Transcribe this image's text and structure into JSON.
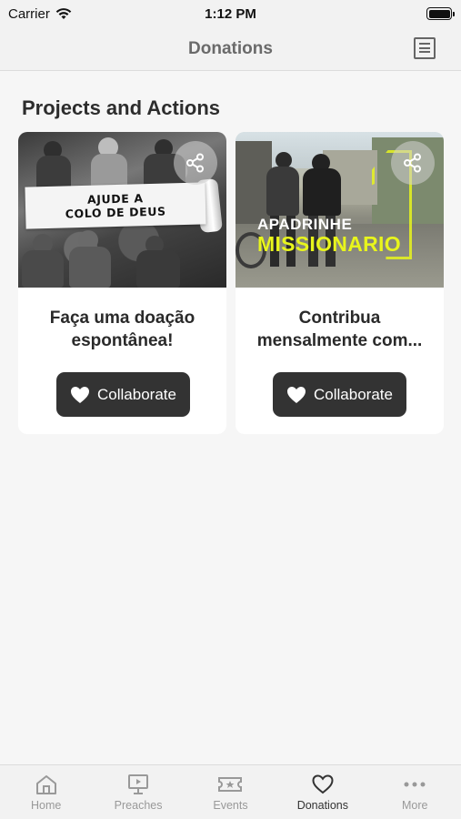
{
  "status_bar": {
    "carrier": "Carrier",
    "time": "1:12 PM",
    "battery_level": 1.0
  },
  "nav": {
    "title": "Donations",
    "right_icon": "document-list-icon"
  },
  "section": {
    "title": "Projects and Actions"
  },
  "cards": [
    {
      "image_banner_lines": [
        "AJUDE A",
        "COLO DE DEUS"
      ],
      "text": "Faça uma doação espontânea!",
      "button_label": "Collaborate",
      "share_icon": "share-icon"
    },
    {
      "image_banner_lines": [
        "APADRINHE",
        "MISSIONARIO"
      ],
      "text": "Contribua mensalmente com...",
      "button_label": "Collaborate",
      "share_icon": "share-icon"
    }
  ],
  "tabs": [
    {
      "label": "Home",
      "icon": "home-icon",
      "active": false
    },
    {
      "label": "Preaches",
      "icon": "presentation-icon",
      "active": false
    },
    {
      "label": "Events",
      "icon": "ticket-icon",
      "active": false
    },
    {
      "label": "Donations",
      "icon": "heart-icon",
      "active": true
    },
    {
      "label": "More",
      "icon": "more-dots-icon",
      "active": false
    }
  ],
  "colors": {
    "button": "#333333",
    "accent_yellow": "#e8f51c",
    "inactive_tab": "#999999",
    "active_tab": "#333333"
  }
}
